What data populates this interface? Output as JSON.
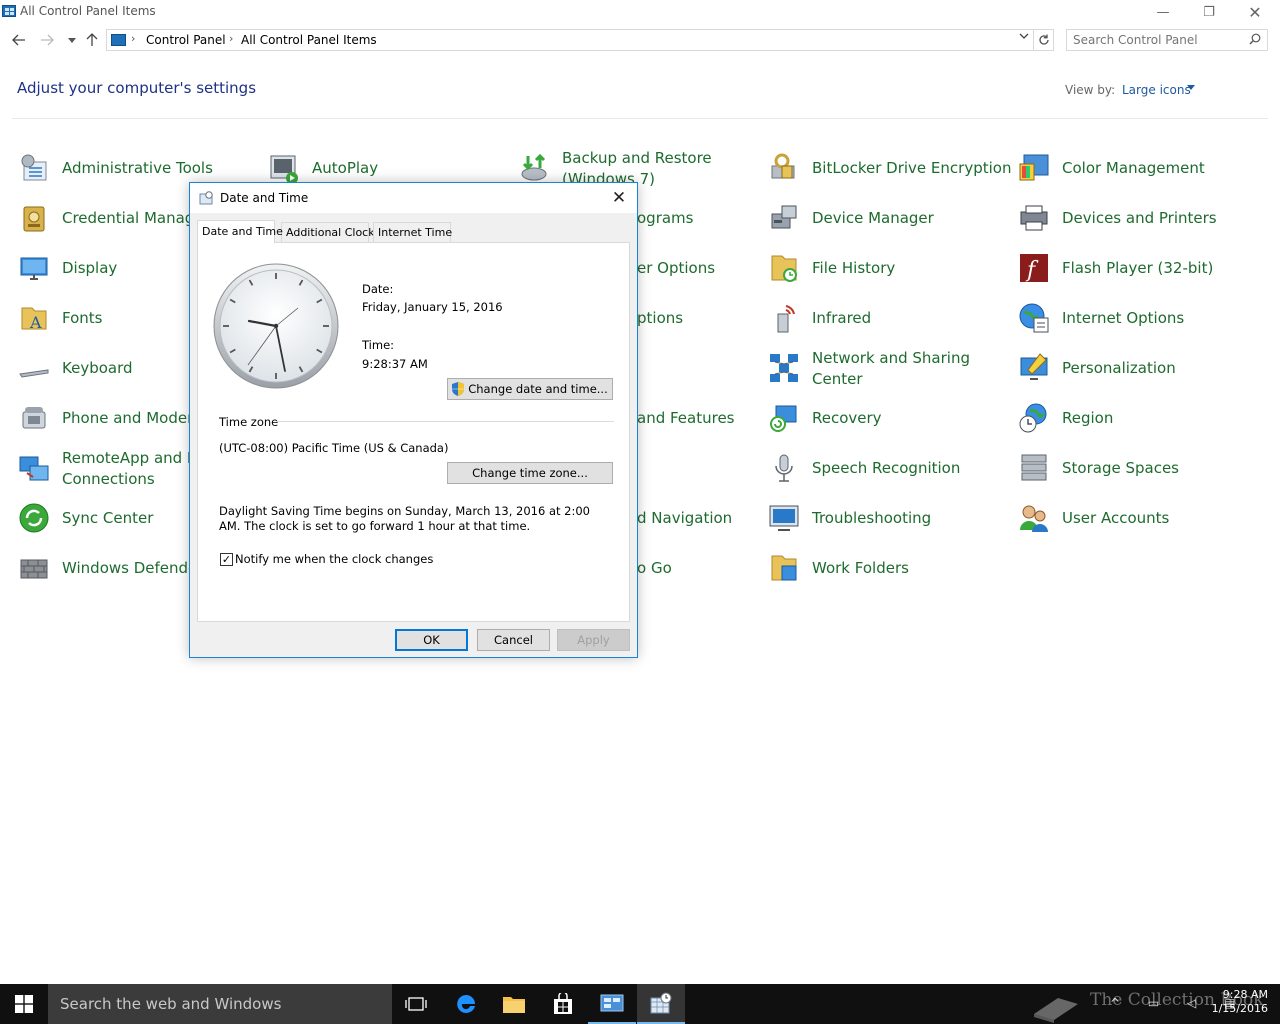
{
  "window": {
    "title": "All Control Panel Items",
    "controls": {
      "minimize": "—",
      "maximize": "❐",
      "close": "✕"
    }
  },
  "nav": {
    "breadcrumbs": [
      "Control Panel",
      "All Control Panel Items"
    ],
    "search_placeholder": "Search Control Panel"
  },
  "header": {
    "title": "Adjust your computer's settings",
    "view_by_label": "View by:",
    "view_by_value": "Large icons"
  },
  "items": {
    "administrative_tools": "Administrative Tools",
    "autoplay": "AutoPlay",
    "backup_restore_1": "Backup and Restore",
    "backup_restore_2": "(Windows 7)",
    "bitlocker": "BitLocker Drive Encryption",
    "color_management": "Color Management",
    "credential_manager": "Credential Manager",
    "programs_partial": "ograms",
    "device_manager": "Device Manager",
    "devices_printers": "Devices and Printers",
    "display": "Display",
    "options_partial": "er Options",
    "file_history": "File History",
    "flash_player": "Flash Player (32-bit)",
    "fonts": "Fonts",
    "ptions_partial": "ptions",
    "infrared": "Infrared",
    "internet_options": "Internet Options",
    "keyboard": "Keyboard",
    "network_sharing_1": "Network and Sharing",
    "network_sharing_2": "Center",
    "personalization": "Personalization",
    "phone_modem": "Phone and Modem",
    "features_partial": "and Features",
    "recovery": "Recovery",
    "region": "Region",
    "remoteapp_1": "RemoteApp and D",
    "remoteapp_2": "Connections",
    "speech": "Speech Recognition",
    "storage_spaces": "Storage Spaces",
    "sync_center": "Sync Center",
    "navigation_partial": "d Navigation",
    "troubleshooting": "Troubleshooting",
    "user_accounts": "User Accounts",
    "windows_defender": "Windows Defender",
    "go_partial": "o Go",
    "work_folders": "Work Folders"
  },
  "dialog": {
    "title": "Date and Time",
    "tabs": [
      "Date and Time",
      "Additional Clocks",
      "Internet Time"
    ],
    "date_label": "Date:",
    "date_value": "Friday, January 15, 2016",
    "time_label": "Time:",
    "time_value": "9:28:37 AM",
    "change_datetime_button": "Change date and time...",
    "timezone_label": "Time zone",
    "timezone_value": "(UTC-08:00) Pacific Time (US & Canada)",
    "change_timezone_button": "Change time zone...",
    "dst_text": "Daylight Saving Time begins on Sunday, March 13, 2016 at 2:00 AM. The clock is set to go forward 1 hour at that time.",
    "notify_label": "Notify me when the clock changes",
    "notify_checked": "✓",
    "ok": "OK",
    "cancel": "Cancel",
    "apply": "Apply"
  },
  "taskbar": {
    "search_text": "Search the web and Windows",
    "time": "9:28 AM",
    "date": "1/15/2016",
    "watermark": "The Collection Book"
  },
  "colors": {
    "item_text": "#1e6b2e",
    "title_text": "#1e3287",
    "accent": "#0078d7"
  }
}
